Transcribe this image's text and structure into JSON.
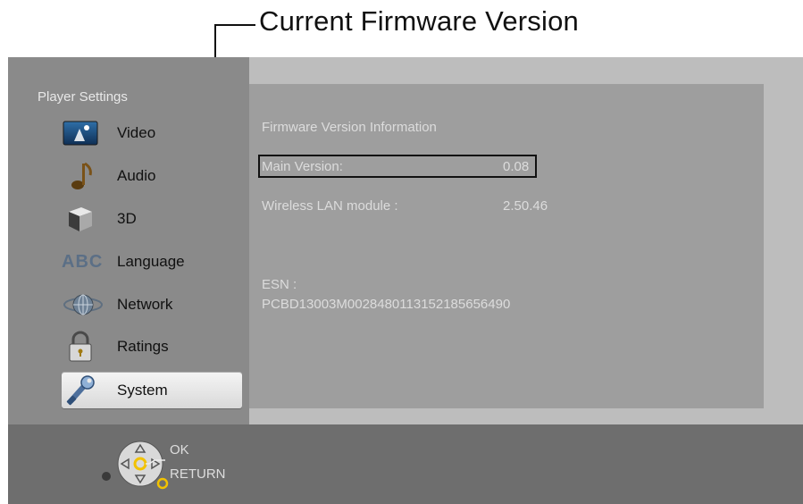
{
  "callout": {
    "title": "Current Firmware Version"
  },
  "sidebar": {
    "title": "Player Settings",
    "items": [
      {
        "label": "Video",
        "icon": "video-icon"
      },
      {
        "label": "Audio",
        "icon": "music-note-icon"
      },
      {
        "label": "3D",
        "icon": "cube-3d-icon"
      },
      {
        "label": "Language",
        "icon": "abc-icon",
        "icon_text": "ABC"
      },
      {
        "label": "Network",
        "icon": "globe-icon"
      },
      {
        "label": "Ratings",
        "icon": "padlock-icon"
      },
      {
        "label": "System",
        "icon": "wrench-icon",
        "selected": true
      }
    ]
  },
  "panel": {
    "heading": "Firmware Version Information",
    "main_version_label": "Main Version:",
    "main_version_value": "0.08",
    "wireless_label": "Wireless LAN module :",
    "wireless_value": "2.50.46",
    "esn_label": "ESN :",
    "esn_value": "PCBD13003M002848011315218565649​0"
  },
  "hints": {
    "ok": "OK",
    "return": "RETURN"
  },
  "colors": {
    "accent_yellow": "#f2c200",
    "selected_bg": "#e6e6e6"
  }
}
